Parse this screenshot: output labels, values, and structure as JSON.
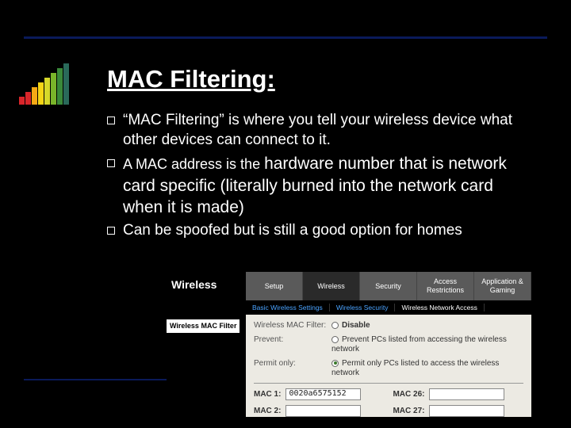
{
  "title": "MAC Filtering:",
  "bullets": {
    "b1": "“MAC Filtering” is where you tell your wireless device what other devices can connect to it.",
    "b2_lead": "A MAC address is the ",
    "b2_rest": "hardware number that is network card specific (literally burned into the network card when it is made)",
    "b3": "Can be spoofed but is still a good option for homes"
  },
  "screenshot": {
    "brand": "Wireless",
    "tabs": [
      "Setup",
      "Wireless",
      "Security",
      "Access Restrictions",
      "Application & Gaming"
    ],
    "active_tab": 1,
    "subtabs": [
      "Basic Wireless Settings",
      "Wireless Security",
      "Wireless Network Access"
    ],
    "side_label": "Wireless MAC Filter",
    "rows": {
      "filter_label": "Wireless MAC Filter:",
      "filter_value": "Disable",
      "prevent_label": "Prevent:",
      "prevent_value": "Prevent PCs listed from accessing the wireless network",
      "permit_label": "Permit only:",
      "permit_value": "Permit only PCs listed to access the wireless network"
    },
    "mac": {
      "m1_label": "MAC 1:",
      "m1_value": "0020a6575152",
      "m2_label": "MAC 2:",
      "m26_label": "MAC 26:",
      "m27_label": "MAC 27:"
    }
  }
}
